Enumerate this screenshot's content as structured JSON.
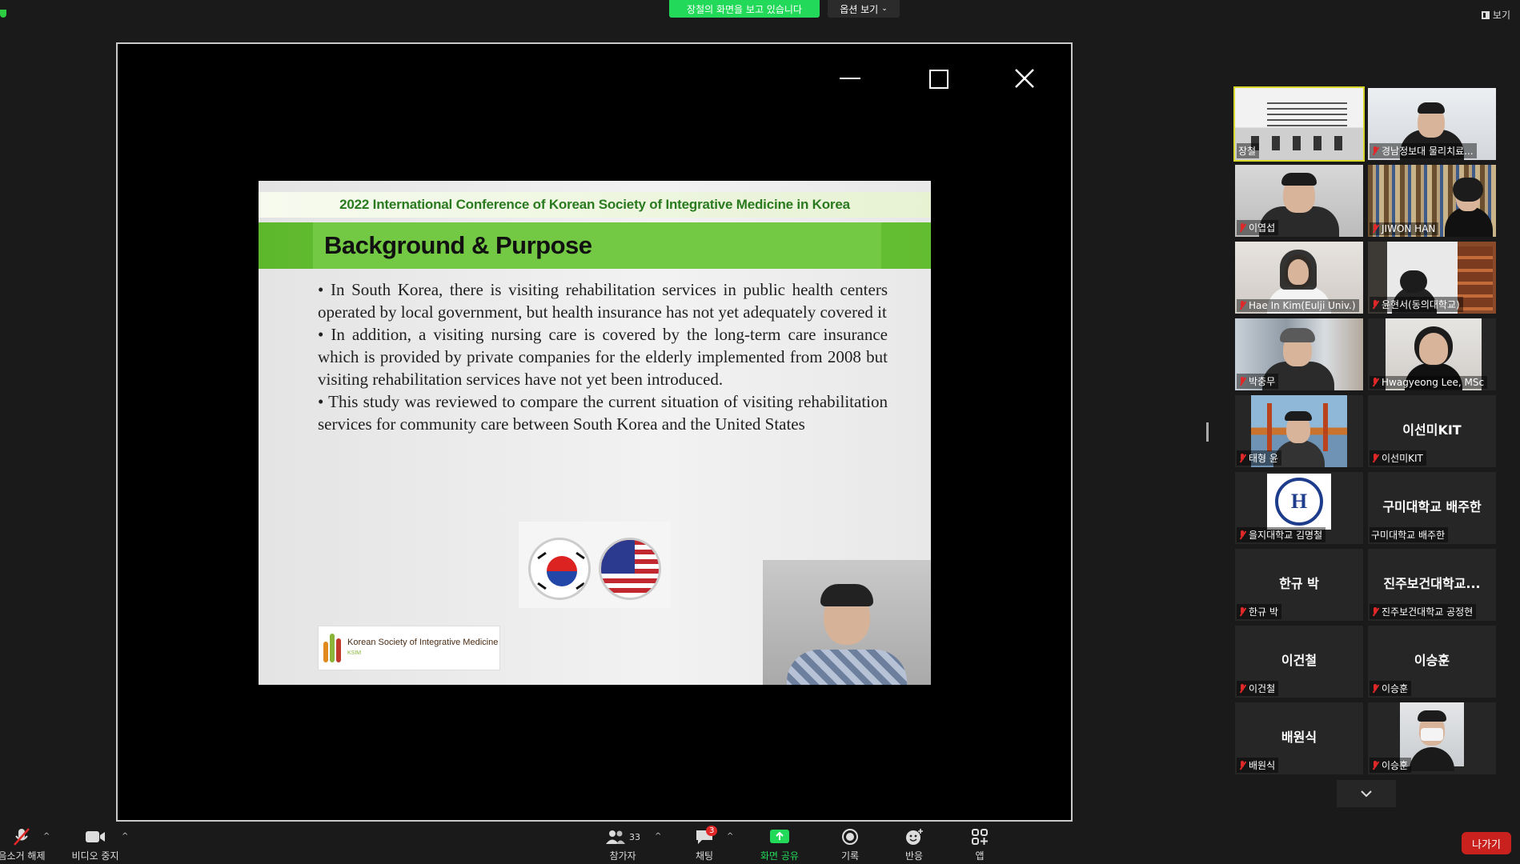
{
  "top": {
    "viewing_banner": "장철의 화면을 보고 있습니다",
    "view_options_label": "옵션 보기",
    "view_label": "보기"
  },
  "slide": {
    "conference_title": "2022 International Conference of  Korean Society of Integrative Medicine in Korea",
    "heading": "Background & Purpose",
    "bullets": [
      "• In South Korea, there is visiting rehabilitation services in public health centers operated by local government, but health insurance has not yet adequately covered it",
      "• In addition, a visiting nursing care is covered by the long-term care insurance which is provided by private companies for the elderly implemented from 2008 but visiting rehabilitation services have not yet been introduced.",
      "• This study was reviewed to compare the current situation of visiting rehabilitation services for community care between South Korea and the United States"
    ],
    "logo_text": "Korean Society of Integrative Medicine",
    "logo_subtext": "KSIM"
  },
  "participants": [
    {
      "name": "장철",
      "muted": false,
      "video": true
    },
    {
      "name": "경남정보대 물리치료...",
      "muted": true,
      "video": true
    },
    {
      "name": "이엽섭",
      "muted": true,
      "video": true
    },
    {
      "name": "JIWON HAN",
      "muted": true,
      "video": true
    },
    {
      "name": "Hae In Kim(Eulji Univ.)",
      "muted": true,
      "video": true
    },
    {
      "name": "윤현서(동의대학교)",
      "muted": true,
      "video": true
    },
    {
      "name": "박충무",
      "muted": true,
      "video": true
    },
    {
      "name": "Hwagyeong Lee, MSc",
      "muted": true,
      "video": true
    },
    {
      "name": "태형 윤",
      "muted": true,
      "video": true
    },
    {
      "name": "이선미KIT",
      "display_name": "이선미KIT",
      "muted": true,
      "video": false
    },
    {
      "name": "을지대학교 김명철",
      "muted": true,
      "video": true
    },
    {
      "name": "구미대학교 배주한",
      "display_name": "구미대학교 배주한",
      "muted": false,
      "video": false
    },
    {
      "name": "한규 박",
      "display_name": "한규 박",
      "muted": true,
      "video": false
    },
    {
      "name": "진주보건대학교 공정현",
      "display_name": "진주보건대학교...",
      "muted": true,
      "video": false
    },
    {
      "name": "이건철",
      "display_name": "이건철",
      "muted": true,
      "video": false
    },
    {
      "name": "이승훈",
      "display_name": "이승훈",
      "muted": true,
      "video": false
    },
    {
      "name": "배원식",
      "display_name": "배원식",
      "muted": true,
      "video": false
    },
    {
      "name": "이승훈",
      "muted": true,
      "video": true
    }
  ],
  "toolbar": {
    "unmute_label": "음소거 해제",
    "stop_video_label": "비디오 중지",
    "participants_label": "참가자",
    "participants_count": "33",
    "chat_label": "채팅",
    "chat_badge": "3",
    "share_label": "화면 공유",
    "record_label": "기록",
    "reactions_label": "반응",
    "apps_label": "앱",
    "leave_label": "나가기"
  },
  "colors": {
    "share_banner": "#23d959",
    "leave": "#c9211e",
    "active_speaker": "#d8d82a"
  }
}
